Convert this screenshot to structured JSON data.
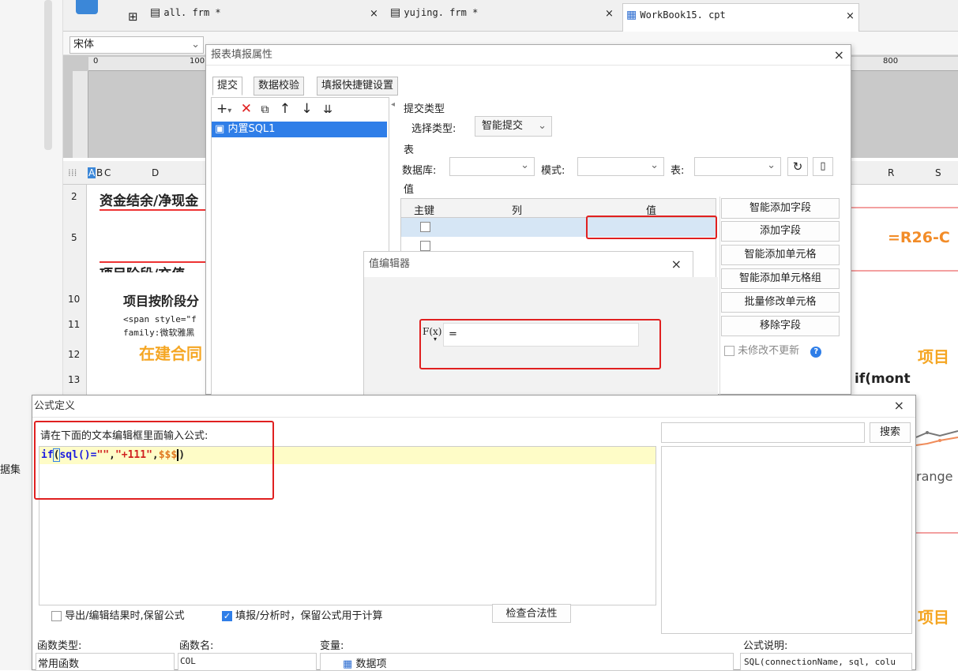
{
  "app": {
    "tabs": [
      {
        "label": "all. frm *"
      },
      {
        "label": "yujing. frm *"
      },
      {
        "label": "WorkBook15. cpt"
      }
    ],
    "font_name": "宋体",
    "ruler": {
      "r0": "0",
      "r100": "100",
      "r800": "800"
    },
    "sheet": {
      "cols": {
        "a": "A",
        "b": "B",
        "c": "C",
        "d": "D",
        "r": "R",
        "s": "S"
      },
      "rows": {
        "r2": "2",
        "r5": "5",
        "r10": "10",
        "r11": "11",
        "r12": "12",
        "r13": "13"
      },
      "cells": {
        "c2": "资金结余/净现金",
        "c_phase": "项目阶段/充值",
        "c10": "项目按阶段分",
        "c11a": "<span style=\"f",
        "c11b": "family:微软雅黑",
        "c12": "在建合同",
        "r_formula": "=R26-C",
        "r_ifmont": "if(mont",
        "r_project1": "项目",
        "r_range": "range",
        "r_project2": "项目"
      }
    },
    "left_label": "据集"
  },
  "report_dialog": {
    "title": "报表填报属性",
    "tabs": [
      "提交",
      "数据校验",
      "填报快捷键设置"
    ],
    "list_item": "内置SQL1",
    "submit_type_section": "提交类型",
    "choose_type_label": "选择类型:",
    "choose_type_value": "智能提交",
    "table_section": "表",
    "db_label": "数据库:",
    "mode_label": "模式:",
    "table_label": "表:",
    "value_section": "值",
    "grid_headers": [
      "主键",
      "列",
      "值"
    ],
    "buttons": [
      "智能添加字段",
      "添加字段",
      "智能添加单元格",
      "智能添加单元格组",
      "批量修改单元格",
      "移除字段"
    ],
    "no_update_label": "未修改不更新"
  },
  "value_editor": {
    "title": "值编辑器",
    "fx_label": "F(x)",
    "value": "="
  },
  "formula_dialog": {
    "title": "公式定义",
    "prompt": "请在下面的文本编辑框里面输入公式:",
    "formula": {
      "fn": "if",
      "p1": "(",
      "fn2": "sql",
      "p2": "()=",
      "s1": "\"\"",
      "c1": ",",
      "s2": "\"+111\"",
      "c2": ",",
      "var": "$$$",
      "p3": ")"
    },
    "search_button": "搜索",
    "keep_formula_export": "导出/编辑结果时,保留公式",
    "keep_formula_fill": "填报/分析时，保留公式用于计算",
    "check_button": "检查合法性",
    "fn_type_label": "函数类型:",
    "fn_name_label": "函数名:",
    "var_label": "变量:",
    "desc_label": "公式说明:",
    "fn_type_value": "常用函数",
    "fn_name_value": "COL",
    "var_value": "数据项",
    "desc_value": "SQL(connectionName, sql, colu"
  }
}
